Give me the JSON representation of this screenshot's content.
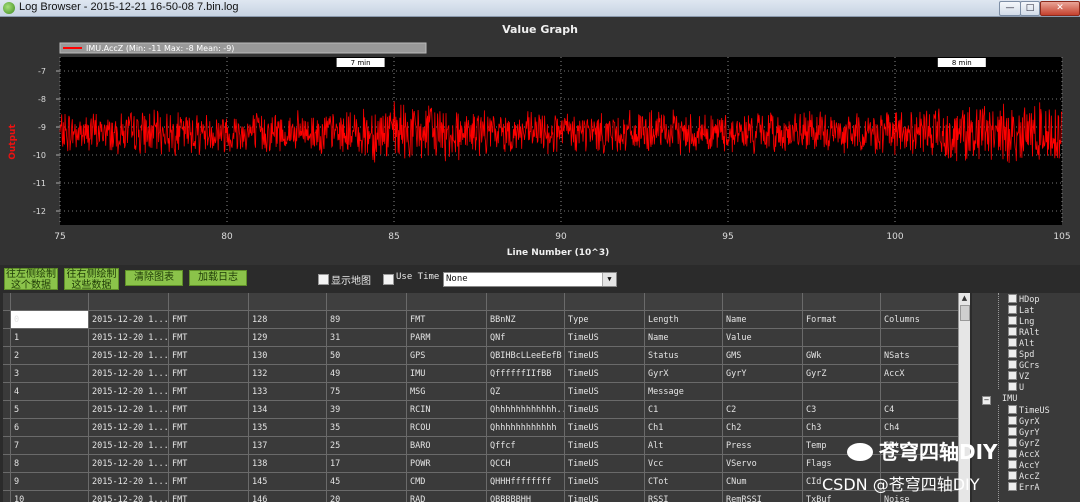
{
  "window": {
    "title": "Log Browser - 2015-12-21 16-50-08 7.bin.log",
    "buttons": [
      "minimize",
      "maximize",
      "close"
    ]
  },
  "graph": {
    "title": "Value Graph",
    "legend": "IMU.AccZ (Min: -11 Max: -8 Mean: -9)",
    "xlabel": "Line Number (10^3)",
    "ylabel": "Output",
    "time_markers": [
      "7 min",
      "8 min"
    ],
    "line_color": "#ff0000"
  },
  "chart_data": {
    "type": "line",
    "title": "Value Graph",
    "xlabel": "Line Number (10^3)",
    "ylabel": "Output",
    "xlim": [
      75,
      105
    ],
    "ylim": [
      -12.5,
      -6.5
    ],
    "x_ticks": [
      "75",
      "80",
      "85",
      "90",
      "95",
      "100",
      "105"
    ],
    "y_ticks": [
      "-7",
      "-8",
      "-9",
      "-10",
      "-11",
      "-12"
    ],
    "series": [
      {
        "name": "IMU.AccZ (Min: -11 Max: -8 Mean: -9)",
        "color": "#ff0000",
        "mean": -9.2,
        "min": -11,
        "max": -8,
        "x_range": [
          75,
          105
        ]
      }
    ],
    "time_markers": [
      {
        "label": "7 min",
        "x": 84
      },
      {
        "label": "8 min",
        "x": 102
      }
    ],
    "grid": true
  },
  "toolbar": {
    "btn_left": "往左侧绘制\n这个数据",
    "btn_right": "往右侧绘制\n这些数据",
    "btn_clear": "清除图表",
    "btn_load": "加载日志",
    "show_map_label": "显示地图",
    "use_time_label": "Use Time",
    "select_value": "None"
  },
  "table": {
    "rows": [
      [
        "0",
        "2015-12-20 1...",
        "FMT",
        "128",
        "89",
        "FMT",
        "BBnNZ",
        "Type",
        "Length",
        "Name",
        "Format",
        "Columns"
      ],
      [
        "1",
        "2015-12-20 1...",
        "FMT",
        "129",
        "31",
        "PARM",
        "QNf",
        "TimeUS",
        "Name",
        "Value",
        "",
        ""
      ],
      [
        "2",
        "2015-12-20 1...",
        "FMT",
        "130",
        "50",
        "GPS",
        "QBIHBcLLeeEefB",
        "TimeUS",
        "Status",
        "GMS",
        "GWk",
        "NSats"
      ],
      [
        "3",
        "2015-12-20 1...",
        "FMT",
        "132",
        "49",
        "IMU",
        "QffffffIIfBB",
        "TimeUS",
        "GyrX",
        "GyrY",
        "GyrZ",
        "AccX"
      ],
      [
        "4",
        "2015-12-20 1...",
        "FMT",
        "133",
        "75",
        "MSG",
        "QZ",
        "TimeUS",
        "Message",
        "",
        "",
        ""
      ],
      [
        "5",
        "2015-12-20 1...",
        "FMT",
        "134",
        "39",
        "RCIN",
        "Qhhhhhhhhhhhh...",
        "TimeUS",
        "C1",
        "C2",
        "C3",
        "C4"
      ],
      [
        "6",
        "2015-12-20 1...",
        "FMT",
        "135",
        "35",
        "RCOU",
        "Qhhhhhhhhhhhh",
        "TimeUS",
        "Ch1",
        "Ch2",
        "Ch3",
        "Ch4"
      ],
      [
        "7",
        "2015-12-20 1...",
        "FMT",
        "137",
        "25",
        "BARO",
        "Qffcf",
        "TimeUS",
        "Alt",
        "Press",
        "Temp",
        "CRt"
      ],
      [
        "8",
        "2015-12-20 1...",
        "FMT",
        "138",
        "17",
        "POWR",
        "QCCH",
        "TimeUS",
        "Vcc",
        "VServo",
        "Flags",
        ""
      ],
      [
        "9",
        "2015-12-20 1...",
        "FMT",
        "145",
        "45",
        "CMD",
        "QHHHffffffff",
        "TimeUS",
        "CTot",
        "CNum",
        "CId",
        ""
      ],
      [
        "10",
        "2015-12-20 1...",
        "FMT",
        "146",
        "20",
        "RAD",
        "QBBBBBHH",
        "TimeUS",
        "RSSI",
        "RemRSSI",
        "TxBuf",
        "Noise"
      ]
    ]
  },
  "tree": {
    "items_top": [
      "HDop",
      "Lat",
      "Lng",
      "RAlt",
      "Alt",
      "Spd",
      "GCrs",
      "VZ",
      "U"
    ],
    "group": "IMU",
    "items_imu": [
      "TimeUS",
      "GyrX",
      "GyrY",
      "GyrZ",
      "AccX",
      "AccY",
      "AccZ",
      "ErrA"
    ]
  },
  "watermark": {
    "line1": "苍穹四轴DIY",
    "line2": "CSDN @苍穹四轴DIY"
  }
}
